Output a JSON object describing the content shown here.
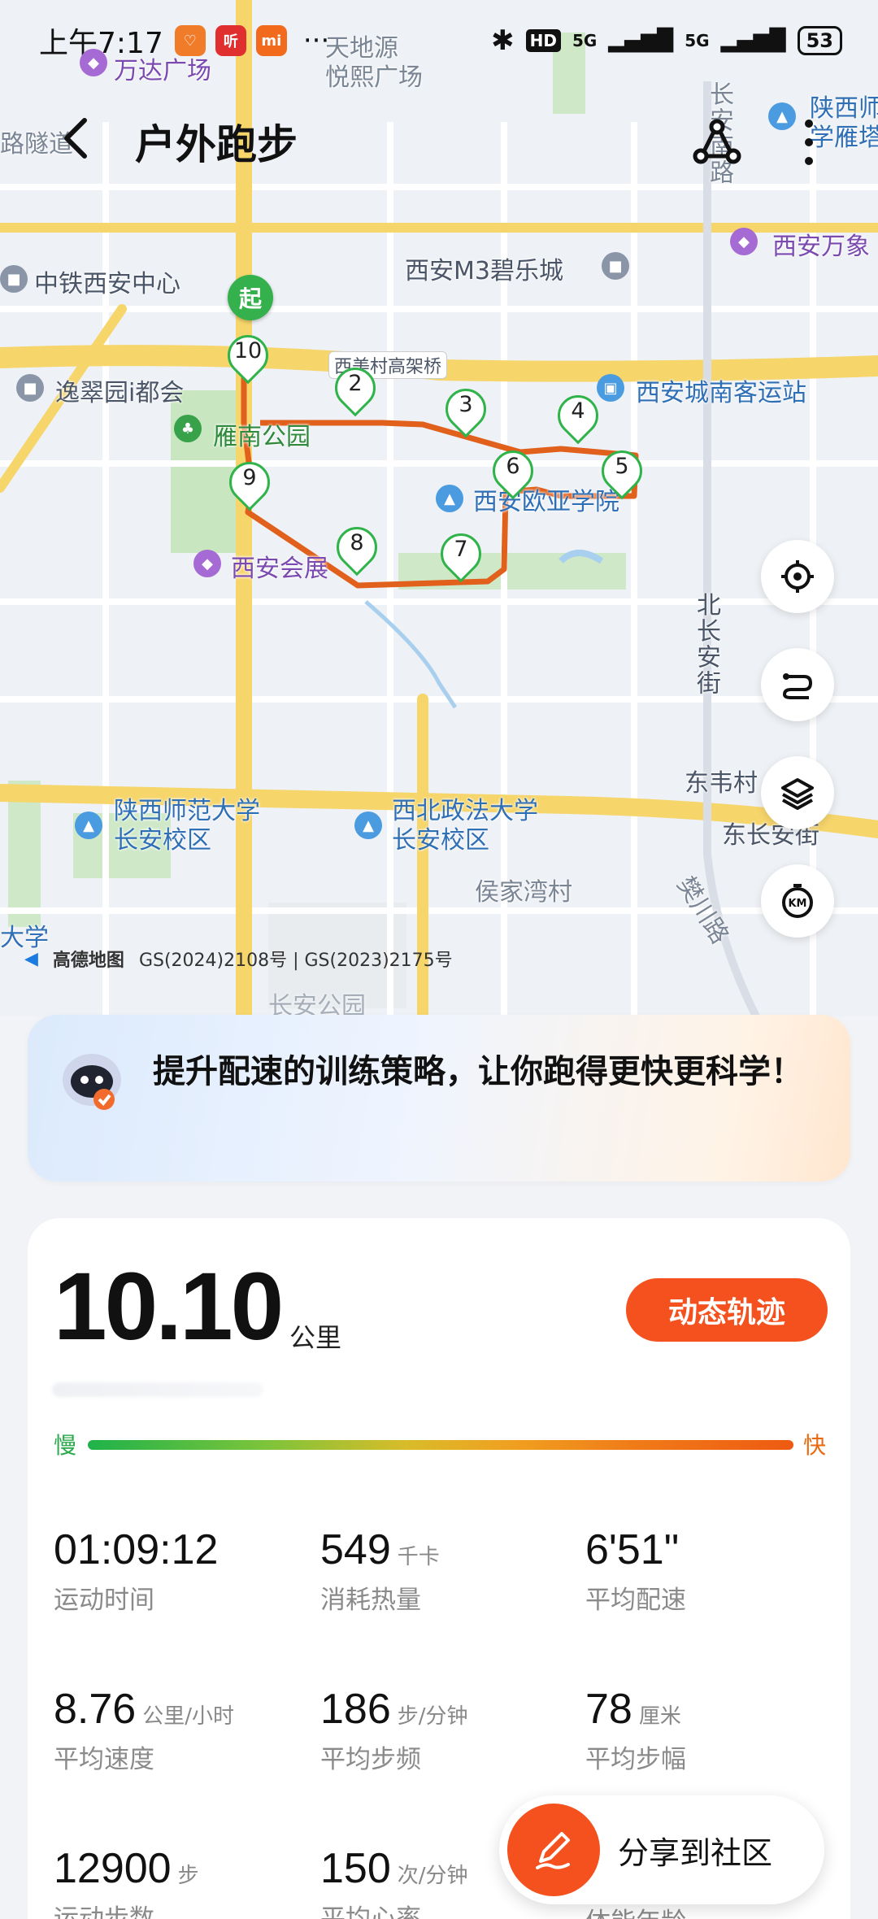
{
  "status_bar": {
    "time": "上午7:17",
    "apps": [
      {
        "glyph": "♡",
        "color": "#f07c2a"
      },
      {
        "glyph": "听",
        "color": "#e02f2f"
      },
      {
        "glyph": "mi",
        "color": "#f26b1d"
      }
    ],
    "more": "···",
    "network_badge": "HD",
    "network_1": "5G",
    "network_2": "5G",
    "battery": "53"
  },
  "header": {
    "title": "户外跑步"
  },
  "map": {
    "labels": {
      "wanda": "万达广场",
      "tiandiyuan": "天地源",
      "yuexi": "悦熙广场",
      "suidao": "路隧道",
      "changan_road": "长安南路",
      "shaanxi_normal_top": "陕西师",
      "shaanxi_normal_top2": "学雁塔",
      "zhongtie": "中铁西安中心",
      "m3": "西安M3碧乐城",
      "xian_wanxiang": "西安万象",
      "yicuiyuan": "逸翠园i都会",
      "gaojiaqiao": "西美村高架桥",
      "bus_station": "西安城南客运站",
      "yanan_park": "雁南公园",
      "ouya": "西安欧亚学院",
      "huizhan": "西安会展",
      "north_changan": "北长安街",
      "dongwei": "东韦村",
      "east_changan": "东长安街",
      "fanchuan": "樊川路",
      "shaanxi_normal": "陕西师范大学长安校区",
      "xibei_law": "西北政法大学长安校区",
      "houjiawan": "侯家湾村",
      "daxue": "大学",
      "changan_park": "长安公园"
    },
    "start_label": "起",
    "km_markers": [
      "2",
      "3",
      "4",
      "5",
      "6",
      "7",
      "8",
      "9",
      "10"
    ],
    "attribution_brand": "高德地图",
    "attribution_codes": "GS(2024)2108号 | GS(2023)2175号",
    "tool_icons": [
      "locate-icon",
      "route-icon",
      "layers-icon",
      "km-icon"
    ],
    "tool_km": "KM",
    "route_color": "#e0601c"
  },
  "banner": {
    "text": "提升配速的训练策略，让你跑得更快更科学！"
  },
  "summary": {
    "distance": "10.10",
    "distance_unit": "公里",
    "dynamic_track": "动态轨迹",
    "pace_slow": "慢",
    "pace_fast": "快",
    "stats": [
      {
        "value": "01:09:12",
        "unit": "",
        "label": "运动时间"
      },
      {
        "value": "549",
        "unit": "千卡",
        "label": "消耗热量"
      },
      {
        "value": "6'51\"",
        "unit": "",
        "label": "平均配速"
      },
      {
        "value": "8.76",
        "unit": "公里/小时",
        "label": "平均速度"
      },
      {
        "value": "186",
        "unit": "步/分钟",
        "label": "平均步频"
      },
      {
        "value": "78",
        "unit": "厘米",
        "label": "平均步幅"
      },
      {
        "value": "12900",
        "unit": "步",
        "label": "运动步数"
      },
      {
        "value": "150",
        "unit": "次/分钟",
        "label": "平均心率"
      },
      {
        "value": "",
        "unit": "",
        "label": "体能年龄"
      }
    ]
  },
  "share": {
    "label": "分享到社区"
  }
}
